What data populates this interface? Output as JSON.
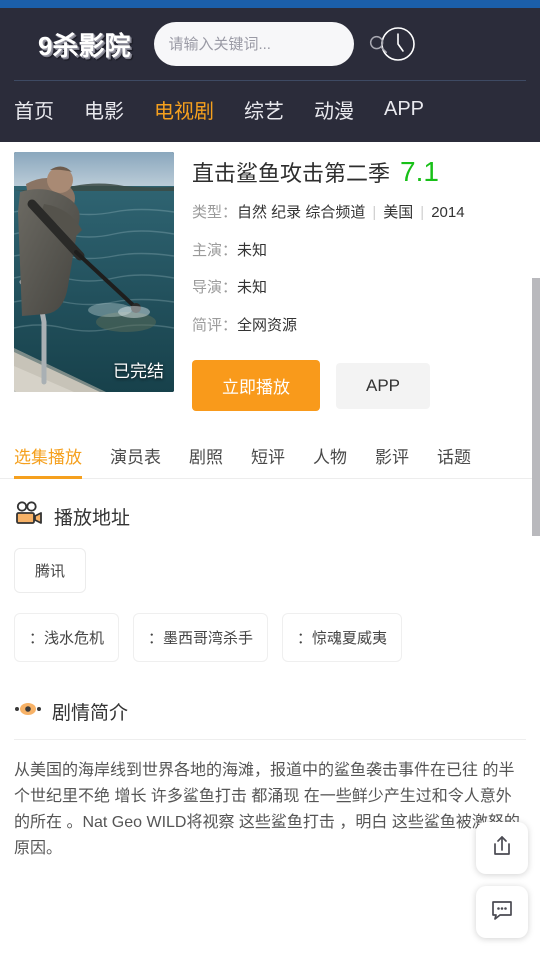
{
  "header": {
    "logo": "9杀影院",
    "search": {
      "placeholder": "请输入关键词...",
      "value": ""
    },
    "search_icon": "search-icon",
    "history_icon": "clock-icon"
  },
  "nav": {
    "items": [
      {
        "label": "首页",
        "active": false
      },
      {
        "label": "电影",
        "active": false
      },
      {
        "label": "电视剧",
        "active": true
      },
      {
        "label": "综艺",
        "active": false
      },
      {
        "label": "动漫",
        "active": false
      },
      {
        "label": "APP",
        "active": false
      }
    ],
    "active_color": "#f5a01e"
  },
  "detail": {
    "poster_badge": "已完结",
    "title": "直击鲨鱼攻击第二季",
    "rating": "7.1",
    "rating_color": "#18c018",
    "meta": [
      {
        "label": "类型：",
        "value": "自然 纪录 综合频道",
        "extra": [
          "美国",
          "2014"
        ]
      },
      {
        "label": "主演：",
        "value": "未知"
      },
      {
        "label": "导演：",
        "value": "未知"
      },
      {
        "label": "简评：",
        "value": "全网资源"
      }
    ],
    "meta_type_label": "类型：",
    "meta_type_value": "自然 纪录 综合频道",
    "meta_region": "美国",
    "meta_year": "2014",
    "meta_actor_label": "主演：",
    "meta_actor_value": "未知",
    "meta_director_label": "导演：",
    "meta_director_value": "未知",
    "meta_review_label": "简评：",
    "meta_review_value": "全网资源",
    "play_button": "立即播放",
    "app_button": "APP"
  },
  "tabs": {
    "items": [
      {
        "label": "选集播放",
        "active": true
      },
      {
        "label": "演员表",
        "active": false
      },
      {
        "label": "剧照",
        "active": false
      },
      {
        "label": "短评",
        "active": false
      },
      {
        "label": "人物",
        "active": false
      },
      {
        "label": "影评",
        "active": false
      },
      {
        "label": "话题",
        "active": false
      }
    ]
  },
  "play_section": {
    "icon": "video-camera-icon",
    "title": "播放地址",
    "sources": [
      {
        "label": "腾讯",
        "active": false
      }
    ],
    "episodes": [
      {
        "label": "：浅水危机"
      },
      {
        "label": "：墨西哥湾杀手"
      },
      {
        "label": "：惊魂夏威夷"
      }
    ]
  },
  "synopsis_section": {
    "icon": "eye-icon",
    "title": "剧情简介",
    "text": "从美国的海岸线到世界各地的海滩，报道中的鲨鱼袭击事件在已往 的半个世纪里不绝 增长 许多鲨鱼打击 都涌现 在一些鲜少产生过和令人意外的所在 。Nat Geo WILD将视察 这些鲨鱼打击 ，明白 这些鲨鱼被激怒的原因。"
  },
  "floating": {
    "share_icon": "share-icon",
    "comment_icon": "comment-icon"
  },
  "theme": {
    "header_bg": "#2b2c3a",
    "top_strip": "#1b5faa",
    "accent": "#f5a01e",
    "play_btn": "#f99a1b"
  }
}
